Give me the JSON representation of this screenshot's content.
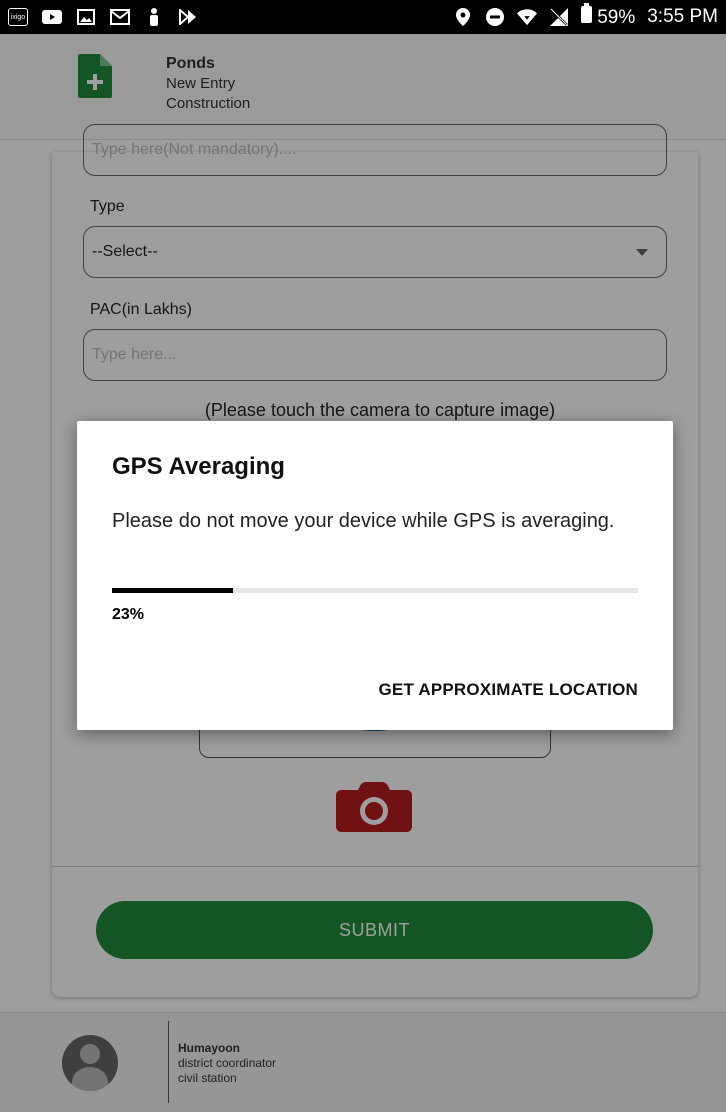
{
  "status_bar": {
    "left_icons": [
      "ixigo-icon",
      "youtube-icon",
      "image-icon",
      "gmail-icon",
      "person-icon",
      "play-arrow-icon"
    ],
    "ixigo_label": "ixigo",
    "right_icons": [
      "location-icon",
      "dnd-icon",
      "wifi-icon",
      "no-sim-icon",
      "battery-icon"
    ],
    "battery": "59%",
    "time": "3:55 PM"
  },
  "header": {
    "title": "Ponds",
    "line1": "New Entry",
    "line2": "Construction",
    "icon": "add-document-icon",
    "accent": "#1f8c3b"
  },
  "form": {
    "remarks_placeholder": "Type here(Not mandatory)....",
    "type_label": "Type",
    "type_value": "--Select--",
    "pac_label": "PAC(in Lakhs)",
    "pac_placeholder": "Type here...",
    "camera_hint": "(Please touch the camera to capture image)",
    "submit_label": "SUBMIT",
    "submit_color": "#1f8c3b",
    "camera_color": "#b71c1c"
  },
  "footer": {
    "name": "Humayoon",
    "role": "district coordinator",
    "location": "civil station"
  },
  "dialog": {
    "title": "GPS Averaging",
    "message": "Please do not move your device while GPS is averaging.",
    "progress": 0.23,
    "progress_label": "23%",
    "action": "GET APPROXIMATE LOCATION"
  }
}
